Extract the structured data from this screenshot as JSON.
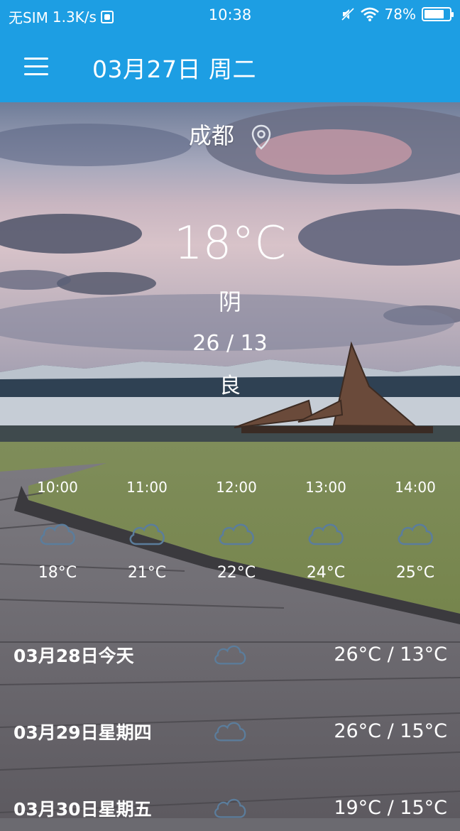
{
  "status_bar": {
    "sim": "无SIM",
    "speed": "1.3K/s",
    "time": "10:38",
    "battery": "78%",
    "battery_level": 0.78
  },
  "app_bar": {
    "title": "03月27日 周二",
    "menu_icon": "menu-icon"
  },
  "current": {
    "city": "成都",
    "location_icon": "location-pin-icon",
    "temperature": "18°C",
    "condition": "阴",
    "range": "26 / 13",
    "air_quality": "良"
  },
  "hourly": [
    {
      "time": "10:00",
      "icon": "cloud-icon",
      "temp": "18°C"
    },
    {
      "time": "11:00",
      "icon": "cloud-icon",
      "temp": "21°C"
    },
    {
      "time": "12:00",
      "icon": "cloud-icon",
      "temp": "22°C"
    },
    {
      "time": "13:00",
      "icon": "cloud-icon",
      "temp": "24°C"
    },
    {
      "time": "14:00",
      "icon": "cloud-icon",
      "temp": "25°C"
    }
  ],
  "daily": [
    {
      "date": "03月28日今天",
      "icon": "cloud-icon",
      "range": "26°C / 13°C"
    },
    {
      "date": "03月29日星期四",
      "icon": "cloud-icon",
      "range": "26°C / 15°C"
    },
    {
      "date": "03月30日星期五",
      "icon": "cloud-icon",
      "range": "19°C / 15°C"
    }
  ],
  "colors": {
    "accent": "#1d9ee3",
    "icon_stroke": "#5b7d9c"
  }
}
